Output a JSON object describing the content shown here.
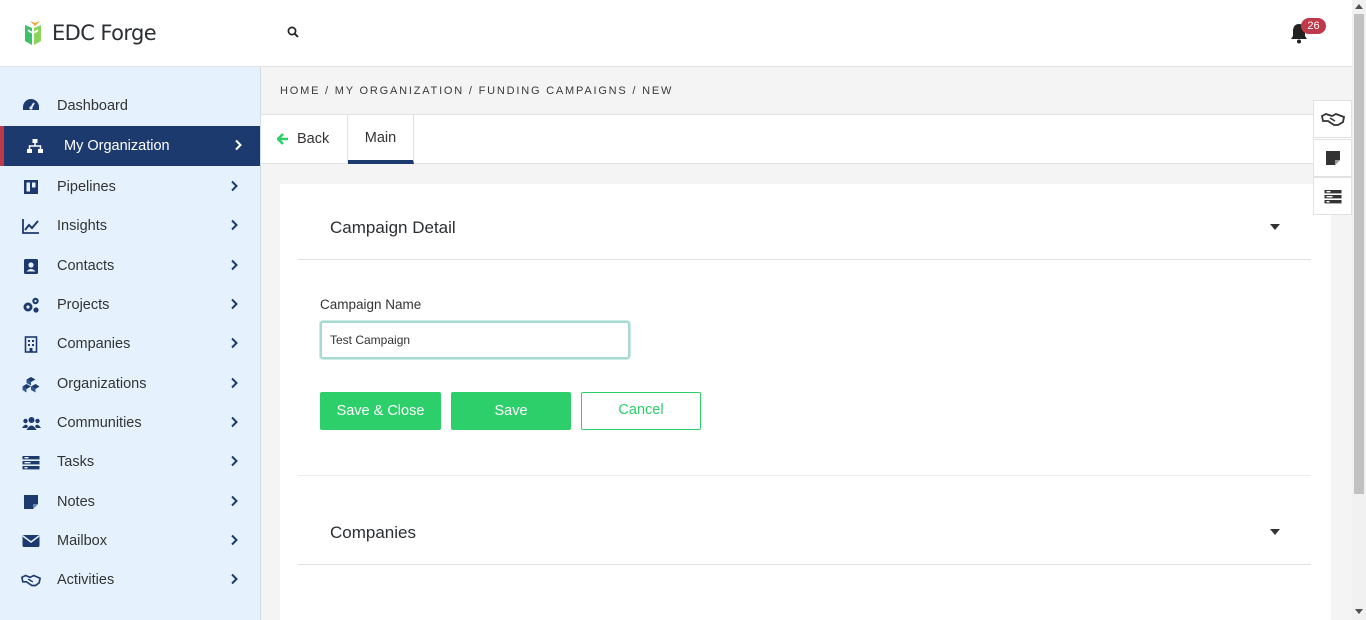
{
  "app": {
    "brand": "EDC Forge"
  },
  "header": {
    "notification_count": "26"
  },
  "sidebar": {
    "items": [
      {
        "label": "Dashboard",
        "icon": "dashboard-icon",
        "active": false,
        "has_submenu": false
      },
      {
        "label": "My Organization",
        "icon": "org-chart-icon",
        "active": true,
        "has_submenu": true
      },
      {
        "label": "Pipelines",
        "icon": "pipeline-icon",
        "active": false,
        "has_submenu": true
      },
      {
        "label": "Insights",
        "icon": "chart-line-icon",
        "active": false,
        "has_submenu": true
      },
      {
        "label": "Contacts",
        "icon": "contact-card-icon",
        "active": false,
        "has_submenu": true
      },
      {
        "label": "Projects",
        "icon": "gears-icon",
        "active": false,
        "has_submenu": true
      },
      {
        "label": "Companies",
        "icon": "building-icon",
        "active": false,
        "has_submenu": true
      },
      {
        "label": "Organizations",
        "icon": "cubes-icon",
        "active": false,
        "has_submenu": true
      },
      {
        "label": "Communities",
        "icon": "users-icon",
        "active": false,
        "has_submenu": true
      },
      {
        "label": "Tasks",
        "icon": "tasks-icon",
        "active": false,
        "has_submenu": true
      },
      {
        "label": "Notes",
        "icon": "note-icon",
        "active": false,
        "has_submenu": true
      },
      {
        "label": "Mailbox",
        "icon": "envelope-icon",
        "active": false,
        "has_submenu": true
      },
      {
        "label": "Activities",
        "icon": "handshake-icon",
        "active": false,
        "has_submenu": true
      }
    ]
  },
  "breadcrumb": "HOME / MY ORGANIZATION / FUNDING CAMPAIGNS / NEW",
  "tabs": {
    "back_label": "Back",
    "main_label": "Main"
  },
  "form": {
    "section_title": "Campaign Detail",
    "campaign_name_label": "Campaign Name",
    "campaign_name_value": "Test Campaign",
    "save_close_label": "Save & Close",
    "save_label": "Save",
    "cancel_label": "Cancel"
  },
  "companies_section": {
    "title": "Companies"
  },
  "colors": {
    "primary_navy": "#1d3a6e",
    "accent_red": "#c0394b",
    "success_green": "#2dcf6a",
    "sidebar_bg": "#e5f2fd"
  }
}
